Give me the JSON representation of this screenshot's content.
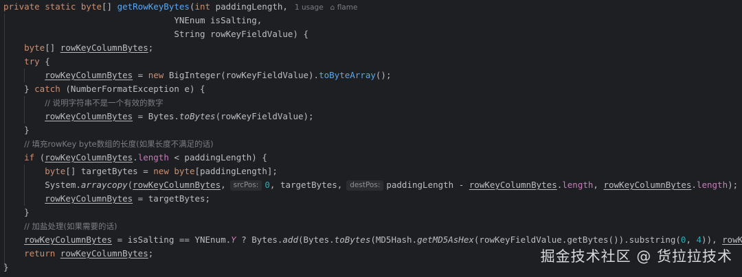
{
  "inlay_hints": {
    "usages": "1 usage",
    "author": "flame",
    "author_icon": "user-icon"
  },
  "param_hints": {
    "src_pos": "srcPos:",
    "dest_pos": "destPos:"
  },
  "comments": {
    "invalid_number": "// 说明字符串不是一个有效的数字",
    "fill_bytes": "// 填充rowKey byte数组的长度(如果长度不满足的话)",
    "salting": "// 加盐处理(如果需要的话)"
  },
  "watermark": "掘金技术社区 @ 货拉拉技术",
  "colors": {
    "background": "#1e1f22",
    "keyword": "#cf8e6d",
    "method": "#56a8f5",
    "field": "#c77dbb",
    "number": "#2aacb8",
    "comment": "#7a7e85",
    "text": "#bcbec4"
  }
}
